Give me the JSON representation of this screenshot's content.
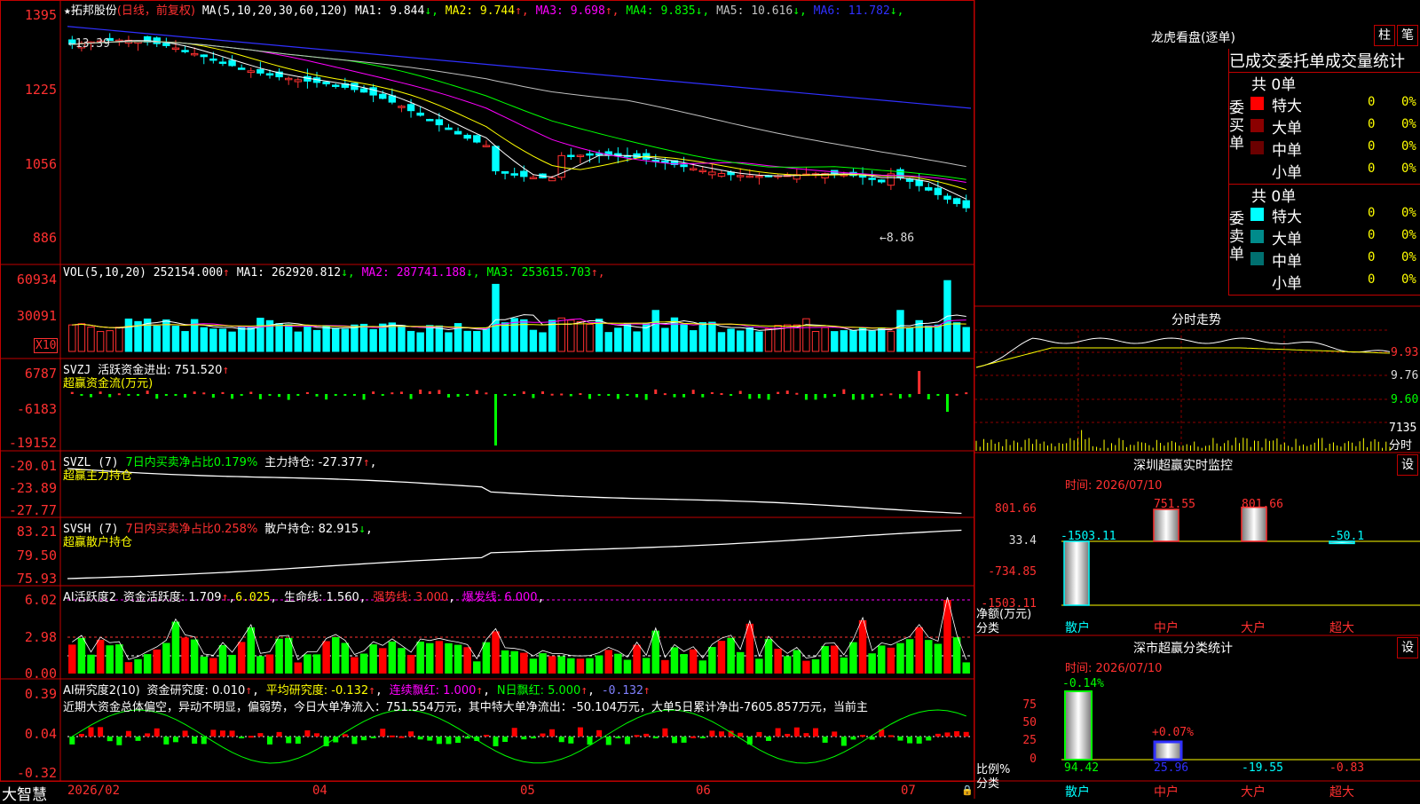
{
  "app_name": "大智慧",
  "stock_header": {
    "star": "★",
    "name": "拓邦股份",
    "period": "(日线，前复权)",
    "ma_label": "MA(5,10,20,30,60,120)",
    "ma": [
      {
        "label": "MA1: 9.844",
        "arrow": "↓",
        "color": "#ffffff"
      },
      {
        "label": "MA2: 9.744",
        "arrow": "↑",
        "color": "#ffff00"
      },
      {
        "label": "MA3: 9.698",
        "arrow": "↑",
        "color": "#ff00ff"
      },
      {
        "label": "MA4: 9.835",
        "arrow": "↓",
        "color": "#00ff00"
      },
      {
        "label": "MA5: 10.616",
        "arrow": "↓",
        "color": "#c0c0c0"
      },
      {
        "label": "MA6: 11.782",
        "arrow": "↓",
        "color": "#3030ff"
      }
    ],
    "price_axis": [
      "1395",
      "1225",
      "1056",
      "886"
    ],
    "high_marker": "←13.39",
    "low_marker": "←8.86"
  },
  "vol_panel": {
    "title": "VOL(5,10,20)",
    "value": "252154.000",
    "ma": [
      {
        "label": "MA1: 262920.812",
        "arrow": "↓",
        "color": "#ffffff"
      },
      {
        "label": "MA2: 287741.188",
        "arrow": "↓",
        "color": "#ff00ff"
      },
      {
        "label": "MA3: 253615.703",
        "arrow": "↑",
        "color": "#00ff00"
      }
    ],
    "axis": [
      "60934",
      "30091"
    ],
    "unit": "X10"
  },
  "svzj_panel": {
    "title": "SVZJ",
    "label": "活跃资金进出: 751.520",
    "arrow": "↑",
    "subtitle": "超赢资金流(万元)",
    "axis": [
      "6787",
      "-6183",
      "-19152"
    ]
  },
  "svzl_panel": {
    "title": "SVZL (7)",
    "label1": "7日内买卖净占比0.179%",
    "label2": "主力持仓: -27.377",
    "arrow": "↑",
    "subtitle": "超赢主力持仓",
    "axis": [
      "-20.01",
      "-23.89",
      "-27.77"
    ]
  },
  "svsh_panel": {
    "title": "SVSH (7)",
    "label1": "7日内买卖净占比0.258%",
    "label2": "散户持仓: 82.915",
    "arrow": "↓",
    "subtitle": "超赢散户持仓",
    "axis": [
      "83.21",
      "79.50",
      "75.93"
    ]
  },
  "ai_active_panel": {
    "title": "AI活跃度2",
    "label1": "资金活跃度: 1.709",
    "label2": "6.025",
    "label3": "生命线: 1.560",
    "label4": "强势线: 3.000",
    "label5": "爆发线: 6.000",
    "axis": [
      "6.02",
      "2.98",
      "0.00"
    ]
  },
  "ai_research_panel": {
    "title": "AI研究度2(10)",
    "label1": "资金研究度: 0.010",
    "label2": "平均研究度: -0.132",
    "label3": "连续飘红: 1.000",
    "label4": "N日飘红: 5.000",
    "label5": "-0.132",
    "commentary": "近期大资金总体偏空，异动不明显，偏弱势，今日大单净流入：751.554万元，其中特大单净流出：-50.104万元，大单5日累计净出-7605.857万元，当前主",
    "axis": [
      "0.39",
      "0.04",
      "-0.32"
    ]
  },
  "date_axis": [
    "2026/02",
    "04",
    "05",
    "06",
    "07"
  ],
  "dragon_tiger": {
    "title": "龙虎看盘(逐单)",
    "tab_zhu": "柱",
    "tab_bi": "笔",
    "heading": "已成交委托单成交量统计",
    "buy_label": "委买单",
    "sell_label": "委卖单",
    "buy_total": "共 0单",
    "sell_total": "共 0单",
    "buy_rows": [
      {
        "name": "特大",
        "count": "0",
        "pct": "0%",
        "color": "#ff0000"
      },
      {
        "name": "大单",
        "count": "0",
        "pct": "0%",
        "color": "#8b0000"
      },
      {
        "name": "中单",
        "count": "0",
        "pct": "0%",
        "color": "#6b0000"
      },
      {
        "name": "小单",
        "count": "0",
        "pct": "0%",
        "color": "#000000"
      }
    ],
    "sell_rows": [
      {
        "name": "特大",
        "count": "0",
        "pct": "0%",
        "color": "#00ffff"
      },
      {
        "name": "大单",
        "count": "0",
        "pct": "0%",
        "color": "#008b8b"
      },
      {
        "name": "中单",
        "count": "0",
        "pct": "0%",
        "color": "#007070"
      },
      {
        "name": "小单",
        "count": "0",
        "pct": "0%",
        "color": "#000000"
      }
    ]
  },
  "intraday": {
    "title": "分时走势",
    "price_axis": [
      "9.93",
      "9.76",
      "9.60"
    ],
    "vol_axis_top": "7135",
    "vol_axis_bottom": "分时"
  },
  "sz_monitor": {
    "title": "深圳超赢实时监控",
    "settings": "设",
    "time": "时间: 2026/07/10",
    "axis": [
      "801.66",
      "33.4",
      "-734.85",
      "-1503.11"
    ],
    "axis_title": "净额(万元)",
    "axis_sub": "分类",
    "categories": [
      "散户",
      "中户",
      "大户",
      "超大"
    ],
    "values": [
      -1503.11,
      751.55,
      801.66,
      -50.1
    ],
    "value_labels": [
      "-1503.11",
      "751.55",
      "801.66",
      "-50.1"
    ]
  },
  "sz_classify": {
    "title": "深市超赢分类统计",
    "settings": "设",
    "time": "时间: 2026/07/10",
    "axis": [
      "75",
      "50",
      "25",
      "0"
    ],
    "axis_title": "比例%",
    "axis_sub": "分类",
    "categories": [
      "散户",
      "中户",
      "大户",
      "超大"
    ],
    "top_labels": [
      "-0.14%",
      "+0.07%"
    ],
    "values": [
      "94.42",
      "25.96",
      "-19.55",
      "-0.83"
    ]
  },
  "chart_data": {
    "type": "candlestick",
    "title": "拓邦股份 (日线，前复权)",
    "ylim": [
      8.86,
      13.95
    ],
    "high": 13.39,
    "low": 8.86,
    "x_ticks": [
      "2026/02",
      "04",
      "05",
      "06",
      "07"
    ]
  }
}
